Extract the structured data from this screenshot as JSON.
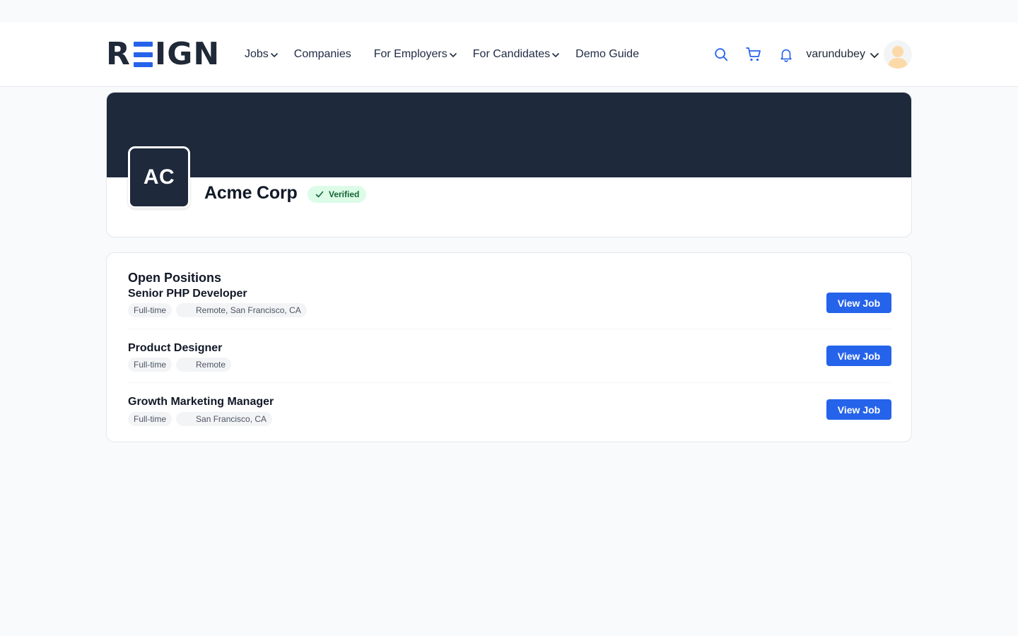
{
  "brand": {
    "logo_pre": "R",
    "logo_post": "IGN",
    "accent": "#2563eb"
  },
  "nav": {
    "items": [
      {
        "label": "Jobs",
        "dropdown": true
      },
      {
        "label": "Companies",
        "dropdown": false
      },
      {
        "label": "For Employers",
        "dropdown": true
      },
      {
        "label": "For Candidates",
        "dropdown": true
      },
      {
        "label": "Demo Guide",
        "dropdown": false
      }
    ],
    "icons": [
      "search-icon",
      "cart-icon",
      "bell-icon"
    ],
    "username": "varundubey"
  },
  "company": {
    "initials": "AC",
    "name": "Acme Corp",
    "badge": "Verified",
    "banner_color": "#1e293b"
  },
  "positions": {
    "title": "Open Positions",
    "jobs": [
      {
        "title": "Senior PHP Developer",
        "type": "Full-time",
        "location": "Remote, San Francisco, CA",
        "button": "View Job"
      },
      {
        "title": "Product Designer",
        "type": "Full-time",
        "location": "Remote",
        "button": "View Job"
      },
      {
        "title": "Growth Marketing Manager",
        "type": "Full-time",
        "location": "San Francisco, CA",
        "button": "View Job"
      }
    ]
  }
}
